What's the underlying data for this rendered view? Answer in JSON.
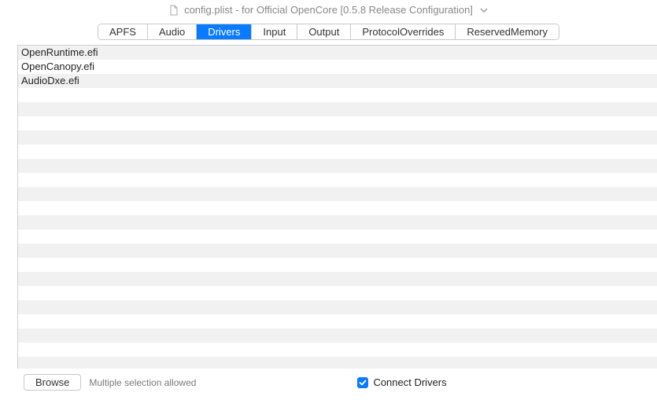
{
  "title": "config.plist - for Official OpenCore [0.5.8 Release Configuration]",
  "tabs": [
    {
      "label": "APFS"
    },
    {
      "label": "Audio"
    },
    {
      "label": "Drivers"
    },
    {
      "label": "Input"
    },
    {
      "label": "Output"
    },
    {
      "label": "ProtocolOverrides"
    },
    {
      "label": "ReservedMemory"
    }
  ],
  "active_tab_index": 2,
  "drivers": [
    "OpenRuntime.efi",
    "OpenCanopy.efi",
    "AudioDxe.efi"
  ],
  "total_rows": 23,
  "browse_label": "Browse",
  "hint": "Multiple selection allowed",
  "connect_drivers_label": "Connect Drivers",
  "connect_drivers_checked": true
}
